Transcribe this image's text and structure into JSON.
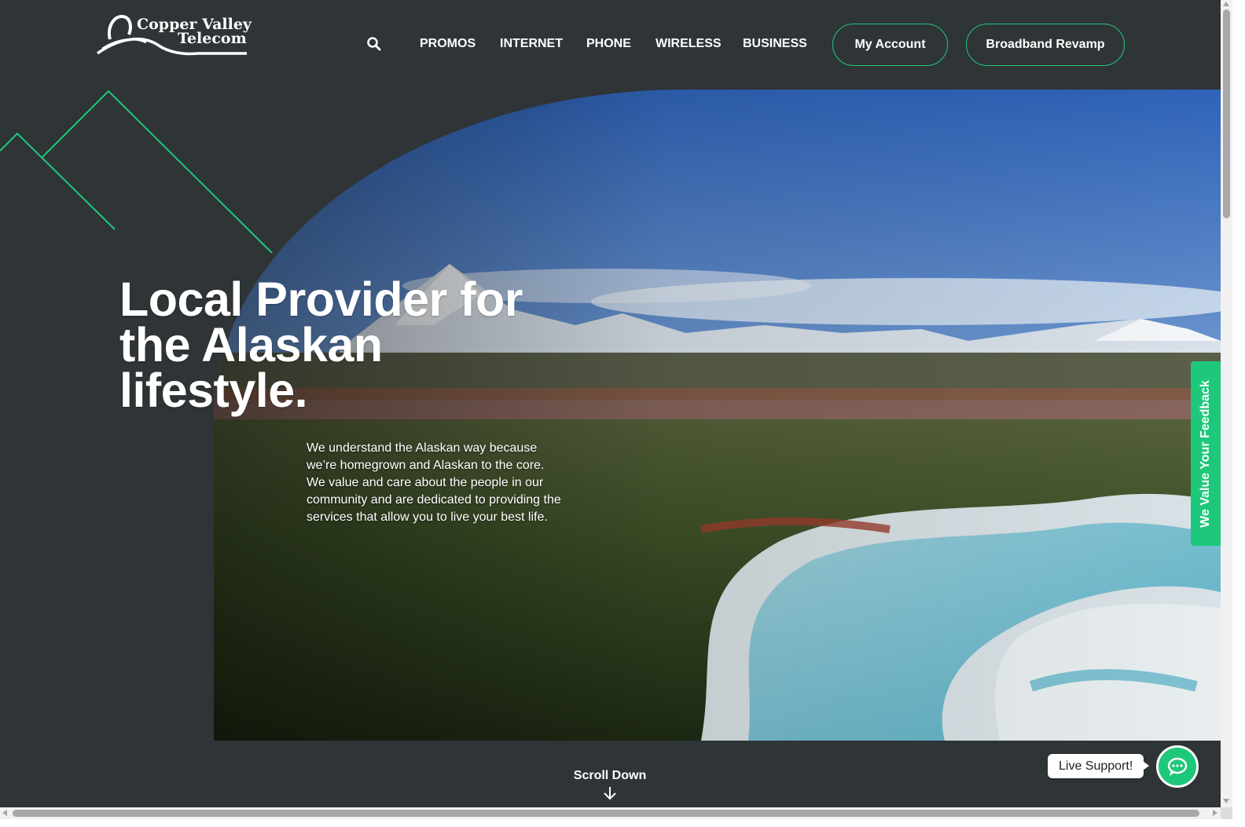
{
  "header": {
    "logo_line1": "Copper Valley",
    "logo_line2": "Telecom",
    "search_icon": "search-icon",
    "nav": [
      {
        "label": "PROMOS"
      },
      {
        "label": "INTERNET"
      },
      {
        "label": "PHONE"
      },
      {
        "label": "WIRELESS"
      },
      {
        "label": "BUSINESS"
      }
    ],
    "my_account_label": "My Account",
    "broadband_label": "Broadband Revamp"
  },
  "hero": {
    "title": "Local Provider for the Alaskan lifestyle.",
    "body": "We understand the Alaskan way because we’re homegrown and Alaskan to the core. We value and care about the people in our community and are dedicated to providing the services that allow you to live your best life."
  },
  "feedback_tab": {
    "label": "We Value Your Feedback"
  },
  "scroll_down": {
    "label": "Scroll Down",
    "icon": "arrow-down-icon"
  },
  "live_support": {
    "label": "Live Support!",
    "icon": "chat-bubble-icon"
  },
  "colors": {
    "background": "#2f3437",
    "accent": "#1ec87a",
    "text": "#ffffff"
  }
}
